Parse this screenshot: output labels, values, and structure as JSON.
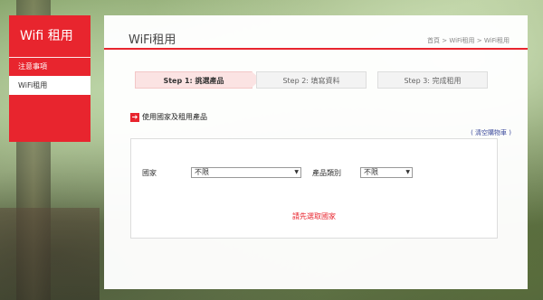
{
  "sidebar": {
    "title": "Wifi 租用",
    "items": [
      {
        "label": "注意事項"
      },
      {
        "label": "WiFi租用"
      }
    ]
  },
  "header": {
    "title": "WiFi租用",
    "breadcrumb": "首頁 > WiFi租用 > WiFi租用"
  },
  "steps": [
    {
      "label": "Step 1: 挑選產品"
    },
    {
      "label": "Step 2: 填寫資料"
    },
    {
      "label": "Step 3: 完成租用"
    }
  ],
  "section": {
    "arrow": "➔",
    "title": "使用國家及租用產品",
    "empty_cart": "( 清空購物車 )"
  },
  "filters": {
    "country_label": "國家",
    "country_value": "不限",
    "category_label": "產品類別",
    "category_value": "不限",
    "caret": "▼"
  },
  "notice": "請先選取國家",
  "colors": {
    "accent": "#e8252e",
    "link": "#3b4a9c"
  }
}
